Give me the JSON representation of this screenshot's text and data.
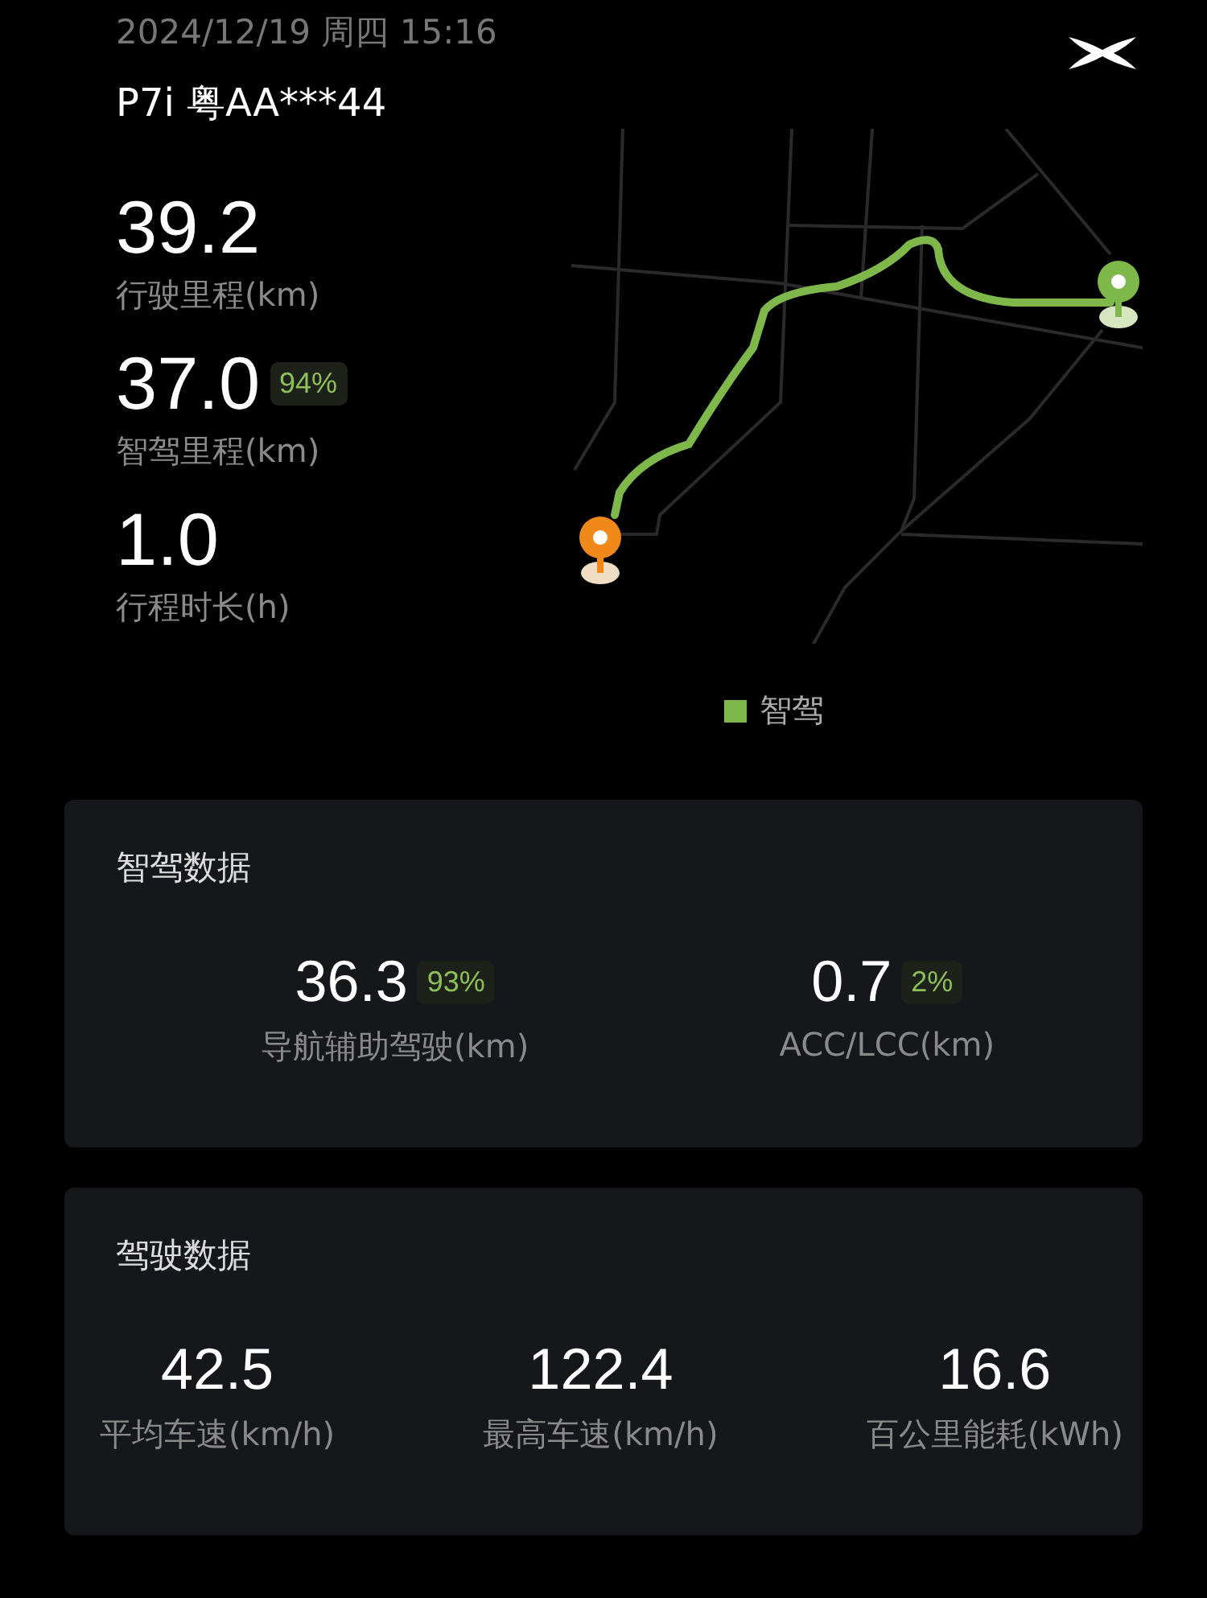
{
  "header": {
    "datetime": "2024/12/19 周四 15:16",
    "vehicle": "P7i 粤AA***44"
  },
  "stats": [
    {
      "value": "39.2",
      "label": "行驶里程(km)"
    },
    {
      "value": "37.0",
      "badge": "94%",
      "label": "智驾里程(km)"
    },
    {
      "value": "1.0",
      "label": "行程时长(h)"
    }
  ],
  "map": {
    "legend": {
      "label": "智驾",
      "color": "#7fb84a"
    }
  },
  "cards": [
    {
      "title": "智驾数据",
      "items": [
        {
          "value": "36.3",
          "badge": "93%",
          "label": "导航辅助驾驶(km)"
        },
        {
          "value": "0.7",
          "badge": "2%",
          "label": "ACC/LCC(km)"
        }
      ]
    },
    {
      "title": "驾驶数据",
      "items": [
        {
          "value": "42.5",
          "label": "平均车速(km/h)"
        },
        {
          "value": "122.4",
          "label": "最高车速(km/h)"
        },
        {
          "value": "16.6",
          "label": "百公里能耗(kWh)"
        }
      ]
    }
  ]
}
